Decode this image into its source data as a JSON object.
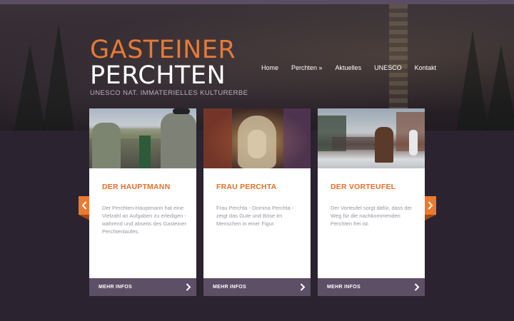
{
  "logo": {
    "line1": "GASTEINER",
    "line2": "PERCHTEN",
    "subtitle": "UNESCO NAT. IMMATERIELLES KULTURERBE"
  },
  "nav": {
    "items": [
      "Home",
      "Perchten »",
      "Aktuelles",
      "UNESCO",
      "Kontakt"
    ]
  },
  "carousel": {
    "prev_icon": "chevron-left-icon",
    "next_icon": "chevron-right-icon"
  },
  "cards": [
    {
      "title": "DER HAUPTMANN",
      "text": "Der Perchten-Hauptmann hat eine Vielzahl an Aufgaben zu erledigen - während und abseits des Gasteiner Perchtenlaufes.",
      "more": "MEHR INFOS"
    },
    {
      "title": "FRAU PERCHTA",
      "text": "Frau Perchta - Domina Perchta - zeigt das Gute und Böse im Menschen in einer Figur.",
      "more": "MEHR INFOS"
    },
    {
      "title": "DER VORTEUFEL",
      "text": "Der Vorteufel sorgt dafür, dass der Weg für die nachkommenden Perchten frei ist.",
      "more": "MEHR INFOS"
    }
  ],
  "colors": {
    "accent": "#e57a3a",
    "background": "#2b2330",
    "button": "#5d4f65"
  }
}
